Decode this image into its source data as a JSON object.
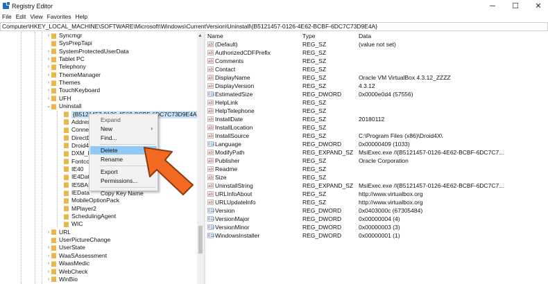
{
  "window": {
    "title": "Registry Editor",
    "minimize": "─",
    "maximize": "☐",
    "close": "✕"
  },
  "menu": [
    "File",
    "Edit",
    "View",
    "Favorites",
    "Help"
  ],
  "address": "Computer\\HKEY_LOCAL_MACHINE\\SOFTWARE\\Microsoft\\Windows\\CurrentVersion\\Uninstall\\{B5121457-0126-4E62-BCBF-6DC7C73D9E4A}",
  "tree": [
    {
      "label": "Syncmgr",
      "level": 0,
      "chev": "›"
    },
    {
      "label": "SysPrepTapi",
      "level": 0,
      "chev": ""
    },
    {
      "label": "SystemProtectedUserData",
      "level": 0,
      "chev": "›"
    },
    {
      "label": "Tablet PC",
      "level": 0,
      "chev": "›"
    },
    {
      "label": "Telephony",
      "level": 0,
      "chev": "›"
    },
    {
      "label": "ThemeManager",
      "level": 0,
      "chev": "›"
    },
    {
      "label": "Themes",
      "level": 0,
      "chev": "›"
    },
    {
      "label": "TouchKeyboard",
      "level": 0,
      "chev": "›"
    },
    {
      "label": "UFH",
      "level": 0,
      "chev": "›"
    },
    {
      "label": "Uninstall",
      "level": 0,
      "chev": "⌄"
    },
    {
      "label": "{B5121457-0126-4E62-BCBF-6DC7C73D9E4A}",
      "level": 1,
      "chev": "",
      "selected": true
    },
    {
      "label": "Address",
      "level": 1,
      "chev": ""
    },
    {
      "label": "Connec",
      "level": 1,
      "chev": ""
    },
    {
      "label": "DirectD",
      "level": 1,
      "chev": ""
    },
    {
      "label": "Droid4X",
      "level": 1,
      "chev": ""
    },
    {
      "label": "DXM_Ru",
      "level": 1,
      "chev": ""
    },
    {
      "label": "Fontcor",
      "level": 1,
      "chev": ""
    },
    {
      "label": "IE40",
      "level": 1,
      "chev": ""
    },
    {
      "label": "IE4Data",
      "level": 1,
      "chev": ""
    },
    {
      "label": "IE5BAKE",
      "level": 1,
      "chev": ""
    },
    {
      "label": "IEData",
      "level": 1,
      "chev": ""
    },
    {
      "label": "MobileOptionPack",
      "level": 1,
      "chev": ""
    },
    {
      "label": "MPlayer2",
      "level": 1,
      "chev": ""
    },
    {
      "label": "SchedulingAgent",
      "level": 1,
      "chev": ""
    },
    {
      "label": "WIC",
      "level": 1,
      "chev": ""
    },
    {
      "label": "URL",
      "level": 0,
      "chev": "›"
    },
    {
      "label": "UserPictureChange",
      "level": 0,
      "chev": ""
    },
    {
      "label": "UserState",
      "level": 0,
      "chev": "›"
    },
    {
      "label": "WaaSAssessment",
      "level": 0,
      "chev": "›"
    },
    {
      "label": "WaasMedic",
      "level": 0,
      "chev": "›"
    },
    {
      "label": "WebCheck",
      "level": 0,
      "chev": "›"
    },
    {
      "label": "WinBio",
      "level": 0,
      "chev": "›"
    }
  ],
  "columns": {
    "name": "Name",
    "type": "Type",
    "data": "Data"
  },
  "values": [
    {
      "name": "(Default)",
      "type": "REG_SZ",
      "data": "(value not set)"
    },
    {
      "name": "AuthorizedCDFPrefix",
      "type": "REG_SZ",
      "data": ""
    },
    {
      "name": "Comments",
      "type": "REG_SZ",
      "data": ""
    },
    {
      "name": "Contact",
      "type": "REG_SZ",
      "data": ""
    },
    {
      "name": "DisplayName",
      "type": "REG_SZ",
      "data": "Oracle VM VirtualBox 4.3.12_ZZZZ"
    },
    {
      "name": "DisplayVersion",
      "type": "REG_SZ",
      "data": "4.3.12"
    },
    {
      "name": "EstimatedSize",
      "type": "REG_DWORD",
      "data": "0x0000e0d4 (57556)"
    },
    {
      "name": "HelpLink",
      "type": "REG_SZ",
      "data": ""
    },
    {
      "name": "HelpTelephone",
      "type": "REG_SZ",
      "data": ""
    },
    {
      "name": "InstallDate",
      "type": "REG_SZ",
      "data": "20180112"
    },
    {
      "name": "InstallLocation",
      "type": "REG_SZ",
      "data": ""
    },
    {
      "name": "InstallSource",
      "type": "REG_SZ",
      "data": "C:\\Program Files (x86)\\Droid4X\\"
    },
    {
      "name": "Language",
      "type": "REG_DWORD",
      "data": "0x00000409 (1033)"
    },
    {
      "name": "ModifyPath",
      "type": "REG_EXPAND_SZ",
      "data": "MsiExec.exe /I{B5121457-0126-4E62-BCBF-6DC7C7..."
    },
    {
      "name": "Publisher",
      "type": "REG_SZ",
      "data": "Oracle Corporation"
    },
    {
      "name": "Readme",
      "type": "REG_SZ",
      "data": ""
    },
    {
      "name": "Size",
      "type": "REG_SZ",
      "data": ""
    },
    {
      "name": "UninstallString",
      "type": "REG_EXPAND_SZ",
      "data": "MsiExec.exe /I{B5121457-0126-4E62-BCBF-6DC7C7..."
    },
    {
      "name": "URLInfoAbout",
      "type": "REG_SZ",
      "data": "http://www.virtualbox.org"
    },
    {
      "name": "URLUpdateInfo",
      "type": "REG_SZ",
      "data": "http://www.virtualbox.org"
    },
    {
      "name": "Version",
      "type": "REG_DWORD",
      "data": "0x0403000c (67305484)"
    },
    {
      "name": "VersionMajor",
      "type": "REG_DWORD",
      "data": "0x00000004 (4)"
    },
    {
      "name": "VersionMinor",
      "type": "REG_DWORD",
      "data": "0x00000003 (3)"
    },
    {
      "name": "WindowsInstaller",
      "type": "REG_DWORD",
      "data": "0x00000001 (1)"
    }
  ],
  "icons": {
    "string": "ab",
    "dword": "011"
  },
  "context_menu": [
    {
      "label": "Expand",
      "disabled": true
    },
    {
      "label": "New",
      "submenu": "›"
    },
    {
      "label": "Find..."
    },
    {
      "sep": true
    },
    {
      "label": "Delete",
      "highlighted": true
    },
    {
      "label": "Rename"
    },
    {
      "sep": true
    },
    {
      "label": "Export"
    },
    {
      "label": "Permissions..."
    },
    {
      "sep": true
    },
    {
      "label": "Copy Key Name"
    }
  ],
  "colors": {
    "arrow": "#f26a21",
    "highlight": "#91c9f7",
    "selection": "#cce4f7"
  }
}
